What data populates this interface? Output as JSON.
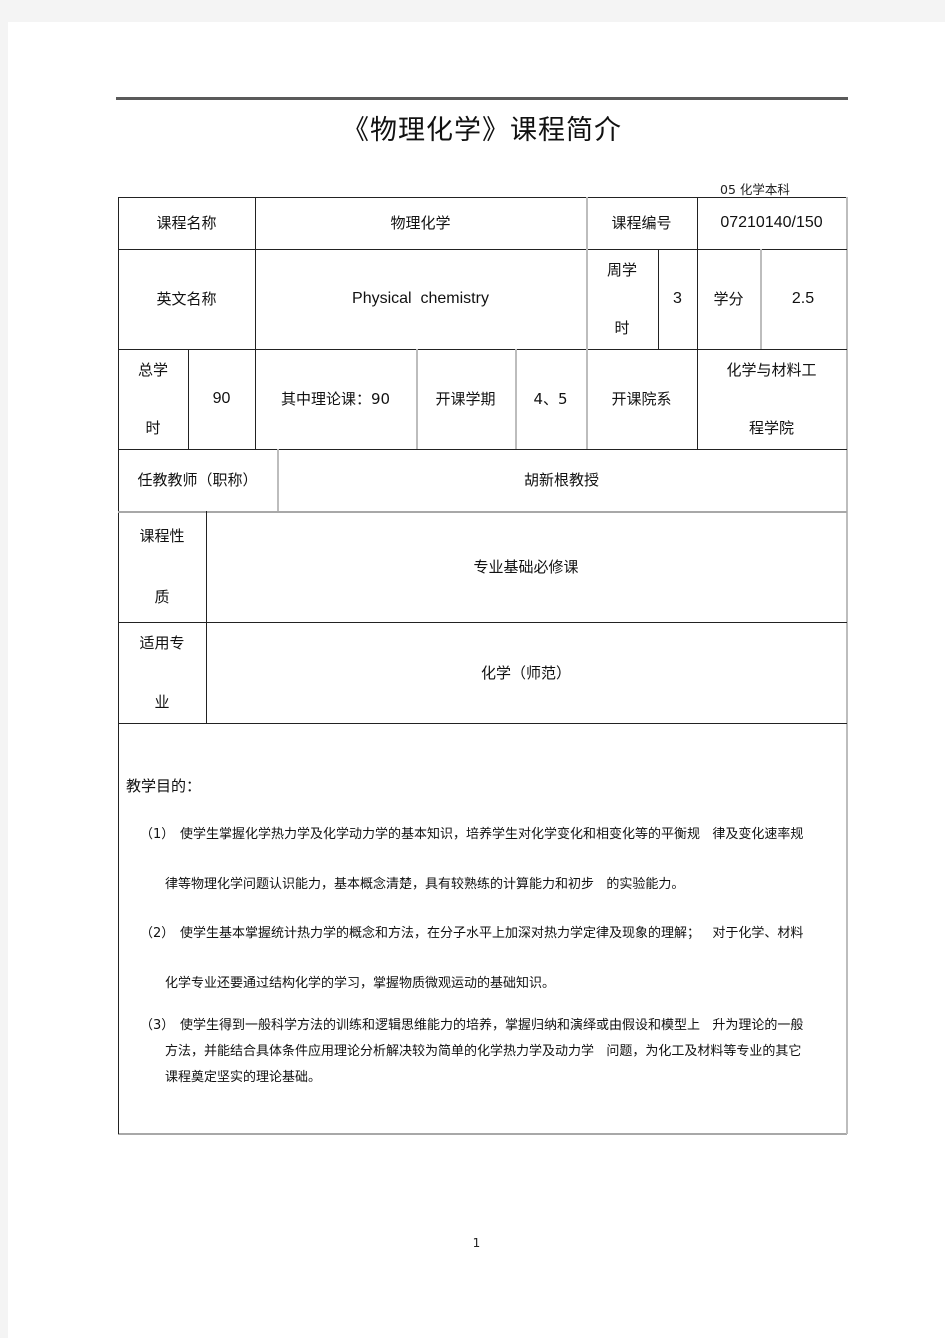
{
  "document": {
    "title": "《物理化学》课程简介",
    "subtitle": "05 化学本科",
    "page_number": "1"
  },
  "table": {
    "row1": {
      "course_name_label": "课程名称",
      "course_name_value": "物理化学",
      "course_code_label": "课程编号",
      "course_code_value": "07210140/150"
    },
    "row2": {
      "english_name_label": "英文名称",
      "english_name_value": "Physical  chemistry",
      "weekly_hours_label_1": "周学",
      "weekly_hours_label_2": "时",
      "weekly_hours_value": "3",
      "credits_label": "学分",
      "credits_value": "2.5"
    },
    "row3": {
      "total_hours_label_1": "总学",
      "total_hours_label_2": "时",
      "total_hours_value": "90",
      "theory_hours": "其中理论课：90",
      "semester_label": "开课学期",
      "semester_value": "4、5",
      "department_label": "开课院系",
      "department_value_1": "化学与材料工",
      "department_value_2": "程学院"
    },
    "row4": {
      "teacher_label": "任教教师（职称）",
      "teacher_value": "胡新根教授"
    },
    "row5": {
      "nature_label_1": "课程性",
      "nature_label_2": "质",
      "nature_value": "专业基础必修课"
    },
    "row6": {
      "major_label_1": "适用专",
      "major_label_2": "业",
      "major_value": "化学（师范）"
    },
    "objectives": {
      "heading": "教学目的：",
      "items": [
        {
          "number": "（1）",
          "line1": "使学生掌握化学热力学及化学动力学的基本知识，培养学生对化学变化和相变化等的平衡规   律及变化速率规",
          "line2": "律等物理化学问题认识能力，基本概念清楚，具有较熟练的计算能力和初步   的实验能力。"
        },
        {
          "number": "（2）",
          "line1": "使学生基本掌握统计热力学的概念和方法，在分子水平上加深对热力学定律及现象的理解；   对于化学、材料",
          "line2": "化学专业还要通过结构化学的学习，掌握物质微观运动的基础知识。"
        },
        {
          "number": "（3）",
          "line1": "使学生得到一般科学方法的训练和逻辑思维能力的培养，掌握归纳和演绎或由假设和模型上   升为理论的一般",
          "line2": "方法，并能结合具体条件应用理论分析解决较为简单的化学热力学及动力学   问题，为化工及材料等专业的其它",
          "line3": "课程奠定坚实的理论基础。"
        }
      ]
    }
  }
}
